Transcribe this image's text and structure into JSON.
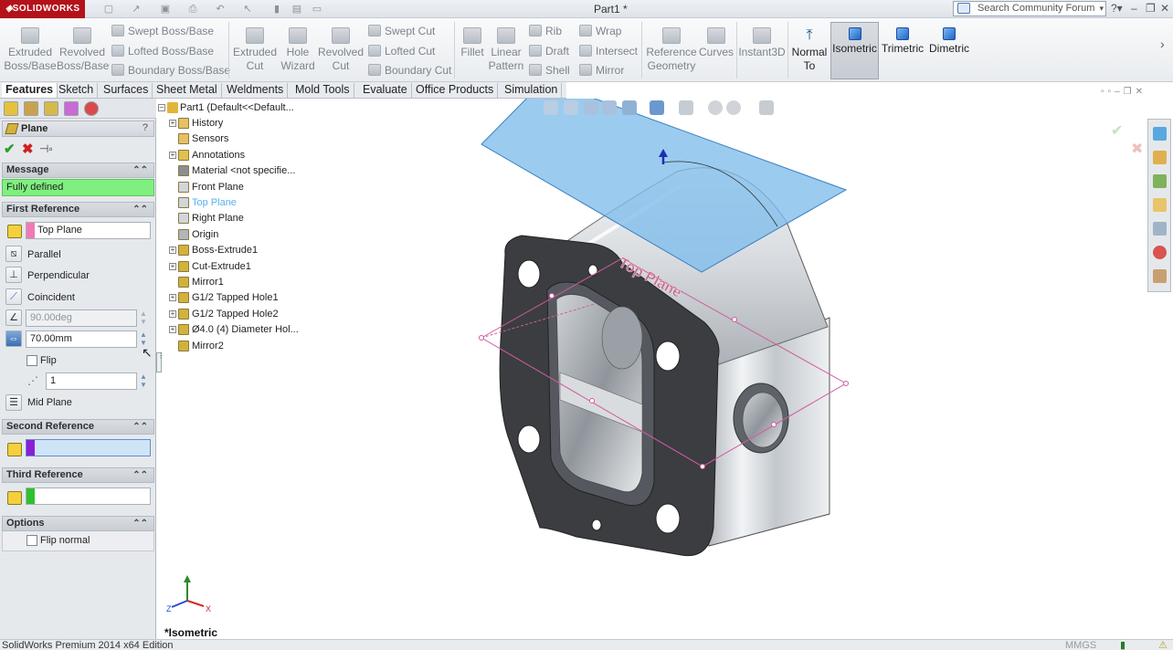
{
  "titlebar": {
    "app_logo": "SOLIDWORKS",
    "doc_title": "Part1 *",
    "search_placeholder": "Search Community Forum"
  },
  "ribbon": {
    "extruded_boss": "Extruded\nBoss/Base",
    "revolved_boss": "Revolved\nBoss/Base",
    "swept_boss": "Swept Boss/Base",
    "lofted_boss": "Lofted Boss/Base",
    "boundary_boss": "Boundary Boss/Base",
    "extruded_cut": "Extruded\nCut",
    "hole_wizard": "Hole\nWizard",
    "revolved_cut": "Revolved\nCut",
    "swept_cut": "Swept Cut",
    "lofted_cut": "Lofted Cut",
    "boundary_cut": "Boundary Cut",
    "fillet": "Fillet",
    "linear_pattern": "Linear\nPattern",
    "rib": "Rib",
    "draft": "Draft",
    "shell": "Shell",
    "wrap": "Wrap",
    "intersect": "Intersect",
    "mirror": "Mirror",
    "reference_geometry": "Reference\nGeometry",
    "curves": "Curves",
    "instant3d": "Instant3D",
    "normal_to": "Normal\nTo",
    "isometric": "Isometric",
    "trimetric": "Trimetric",
    "dimetric": "Dimetric"
  },
  "tabs": [
    "Features",
    "Sketch",
    "Surfaces",
    "Sheet Metal",
    "Weldments",
    "Mold Tools",
    "Evaluate",
    "Office Products",
    "Simulation"
  ],
  "propertymanager": {
    "title": "Plane",
    "message_header": "Message",
    "message": "Fully defined",
    "first_reference_header": "First Reference",
    "first_reference_value": "Top Plane",
    "parallel": "Parallel",
    "perpendicular": "Perpendicular",
    "coincident": "Coincident",
    "angle_value": "90.00deg",
    "distance_value": "70.00mm",
    "flip": "Flip",
    "instances_value": "1",
    "mid_plane": "Mid Plane",
    "second_reference_header": "Second Reference",
    "third_reference_header": "Third Reference",
    "options_header": "Options",
    "flip_normal": "Flip normal",
    "colors": {
      "first": "#f07ab8",
      "second": "#8a1fd6",
      "third": "#2ec02e",
      "message_bg": "#7ff07f"
    }
  },
  "feature_tree": {
    "root": "Part1  (Default<<Default...",
    "items": [
      {
        "label": "History",
        "expander": true,
        "icon": "folder-icon"
      },
      {
        "label": "Sensors",
        "expander": false,
        "icon": "folder-icon"
      },
      {
        "label": "Annotations",
        "expander": true,
        "icon": "annotation-icon"
      },
      {
        "label": "Material <not specifie...",
        "expander": false,
        "icon": "material-icon"
      },
      {
        "label": "Front Plane",
        "expander": false,
        "icon": "plane-icon"
      },
      {
        "label": "Top Plane",
        "expander": false,
        "icon": "plane-icon",
        "highlighted": true
      },
      {
        "label": "Right Plane",
        "expander": false,
        "icon": "plane-icon"
      },
      {
        "label": "Origin",
        "expander": false,
        "icon": "origin-icon"
      },
      {
        "label": "Boss-Extrude1",
        "expander": true,
        "icon": "feature-icon"
      },
      {
        "label": "Cut-Extrude1",
        "expander": true,
        "icon": "feature-icon"
      },
      {
        "label": "Mirror1",
        "expander": false,
        "icon": "feature-icon"
      },
      {
        "label": "G1/2 Tapped Hole1",
        "expander": true,
        "icon": "feature-icon"
      },
      {
        "label": "G1/2 Tapped Hole2",
        "expander": true,
        "icon": "feature-icon"
      },
      {
        "label": "Ø4.0 (4) Diameter Hol...",
        "expander": true,
        "icon": "feature-icon"
      },
      {
        "label": "Mirror2",
        "expander": false,
        "icon": "feature-icon"
      }
    ]
  },
  "viewport": {
    "view_name": "*Isometric",
    "plane_label": "Top Plane"
  },
  "statusbar": {
    "edition": "SolidWorks Premium 2014 x64 Edition",
    "units": "MMGS"
  }
}
